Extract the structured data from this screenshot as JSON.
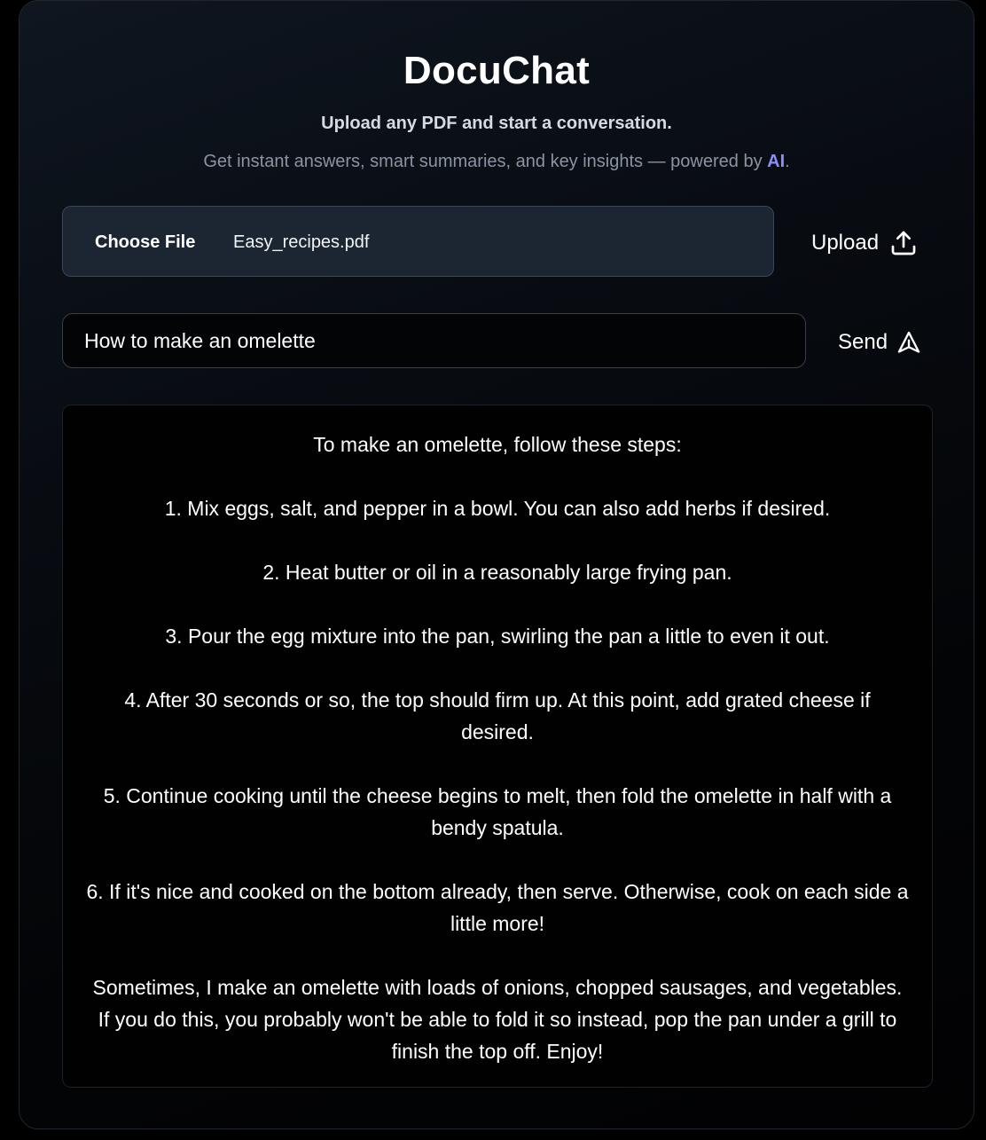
{
  "app": {
    "title": "DocuChat",
    "subtitle": "Upload any PDF and start a conversation.",
    "tagline_before": "Get instant answers, smart summaries, and key insights — powered by ",
    "tagline_highlight": "AI",
    "tagline_after": "."
  },
  "upload": {
    "choose_file_label": "Choose File",
    "file_name": "Easy_recipes.pdf",
    "upload_label": "Upload",
    "icon": "upload-icon"
  },
  "query": {
    "value": "How to make an omelette",
    "send_label": "Send",
    "icon": "send-icon"
  },
  "answer": {
    "paragraphs": [
      "To make an omelette, follow these steps:",
      "1. Mix eggs, salt, and pepper in a bowl. You can also add herbs if desired.",
      "2. Heat butter or oil in a reasonably large frying pan.",
      "3. Pour the egg mixture into the pan, swirling the pan a little to even it out.",
      "4. After 30 seconds or so, the top should firm up. At this point, add grated cheese if desired.",
      "5. Continue cooking until the cheese begins to melt, then fold the omelette in half with a bendy spatula.",
      "6. If it's nice and cooked on the bottom already, then serve. Otherwise, cook on each side a little more!",
      "Sometimes, I make an omelette with loads of onions, chopped sausages, and vegetables. If you do this, you probably won't be able to fold it so instead, pop the pan under a grill to finish the top off. Enjoy!"
    ]
  },
  "colors": {
    "accent": "#8b8ff5",
    "background": "#000000",
    "file_box": "#1c2633"
  }
}
